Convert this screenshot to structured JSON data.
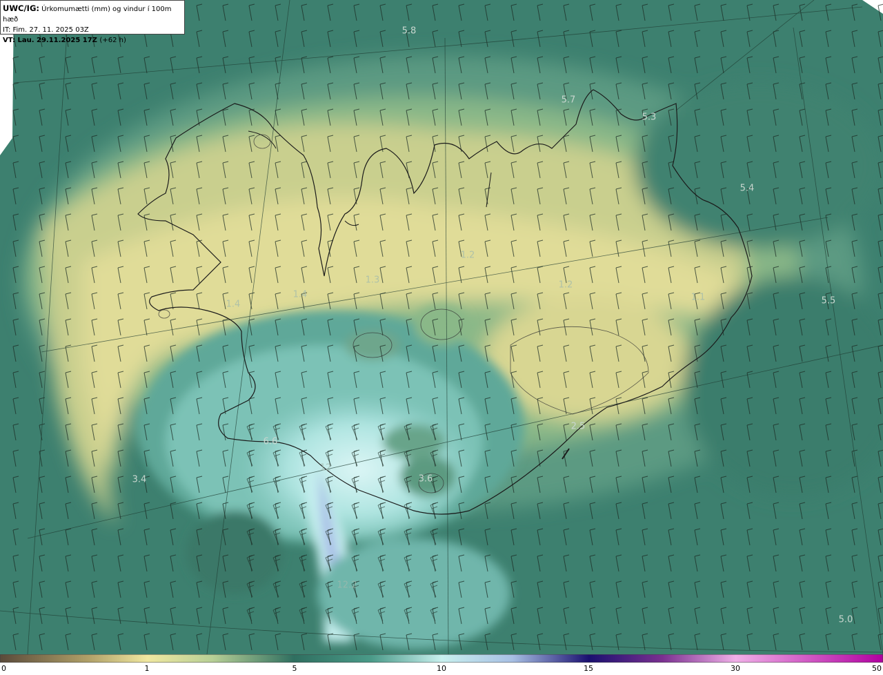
{
  "info": {
    "title_bold": "UWC/IG:",
    "title_rest": "Úrkomumætti (mm) og vindur í 100m hæð",
    "initial_time": "IT: Fim. 27. 11. 2025 03Z",
    "valid_bold": "VT: Lau. 29.11.2025 17Z",
    "valid_rest": "(+62 h)"
  },
  "contour_labels": [
    {
      "text": "5.8",
      "key": "a"
    },
    {
      "text": "5.7",
      "key": "b"
    },
    {
      "text": "5.3",
      "key": "c"
    },
    {
      "text": "5.4",
      "key": "d"
    },
    {
      "text": "5.5",
      "key": "e"
    },
    {
      "text": "6.6",
      "key": "f"
    },
    {
      "text": "3.4",
      "key": "g"
    },
    {
      "text": "3.6",
      "key": "h"
    },
    {
      "text": "2.5",
      "key": "i"
    },
    {
      "text": "5.0",
      "key": "j"
    },
    {
      "text": "1.2",
      "key": "k"
    },
    {
      "text": "1.3",
      "key": "l"
    },
    {
      "text": "1.4",
      "key": "m"
    },
    {
      "text": "1.4",
      "key": "n"
    },
    {
      "text": "1.2",
      "key": "o"
    },
    {
      "text": "1.1",
      "key": "p"
    },
    {
      "text": "12",
      "key": "q"
    },
    {
      "text": "12.2",
      "key": "r"
    }
  ],
  "colorbar": {
    "ticks": [
      "0",
      "1",
      "5",
      "10",
      "15",
      "30",
      "50"
    ],
    "stops": [
      "#5a4a3a",
      "#9a8a5a",
      "#d9d08a",
      "#f0e8a0",
      "#e6e09a",
      "#a8c890",
      "#5a9a80",
      "#2f6f60",
      "#3a8a7a",
      "#7ac0b8",
      "#c8f0ee",
      "#e8fafa",
      "#a0b8e0",
      "#2a2a8a",
      "#1a1060",
      "#6a2080",
      "#c060b0",
      "#f0a0e0",
      "#d040c0",
      "#b000a0"
    ],
    "colors": {
      "low": "#5a4a3a",
      "mid": "#2f6f60",
      "high": "#b000a0"
    }
  },
  "map": {
    "ocean_color": "#3a7a6a",
    "land_color": "#d6d890",
    "wind_barb_color": "#1a2a22",
    "coast_color": "#1a1a1a"
  }
}
